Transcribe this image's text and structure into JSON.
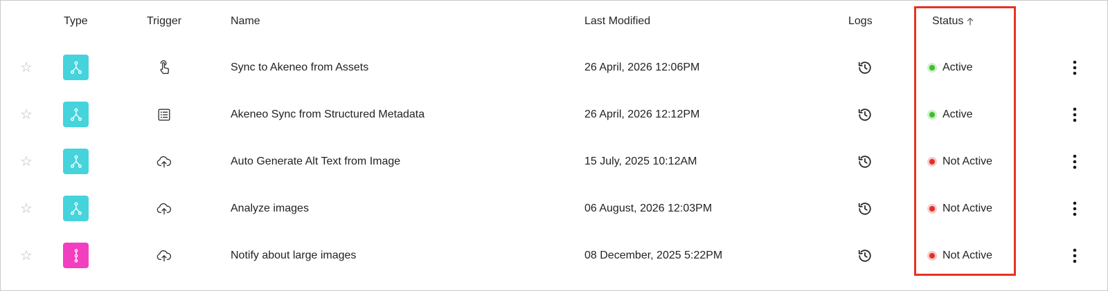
{
  "table": {
    "headers": {
      "type": "Type",
      "trigger": "Trigger",
      "name": "Name",
      "last_modified": "Last Modified",
      "logs": "Logs",
      "status": "Status",
      "status_sort_icon": "arrow-up-icon"
    },
    "rows": [
      {
        "star_icon": "star-outline-icon",
        "type_icon": "workflow-branch-icon",
        "type_color": "#45d3dc",
        "trigger_icon": "tap-hand-icon",
        "name": "Sync to Akeneo from Assets",
        "last_modified": "26 April, 2026 12:06PM",
        "logs_icon": "history-icon",
        "status": "Active",
        "status_color": "#3fbf2a",
        "menu_icon": "more-vertical-icon"
      },
      {
        "star_icon": "star-outline-icon",
        "type_icon": "workflow-branch-icon",
        "type_color": "#45d3dc",
        "trigger_icon": "list-document-icon",
        "name": "Akeneo Sync from Structured Metadata",
        "last_modified": "26 April, 2026 12:12PM",
        "logs_icon": "history-icon",
        "status": "Active",
        "status_color": "#3fbf2a",
        "menu_icon": "more-vertical-icon"
      },
      {
        "star_icon": "star-outline-icon",
        "type_icon": "workflow-branch-icon",
        "type_color": "#45d3dc",
        "trigger_icon": "cloud-upload-icon",
        "name": "Auto Generate Alt Text from Image",
        "last_modified": "15 July, 2025 10:12AM",
        "logs_icon": "history-icon",
        "status": "Not Active",
        "status_color": "#e0302a",
        "menu_icon": "more-vertical-icon"
      },
      {
        "star_icon": "star-outline-icon",
        "type_icon": "workflow-branch-icon",
        "type_color": "#45d3dc",
        "trigger_icon": "cloud-upload-icon",
        "name": "Analyze images",
        "last_modified": "06 August, 2026 12:03PM",
        "logs_icon": "history-icon",
        "status": "Not Active",
        "status_color": "#e0302a",
        "menu_icon": "more-vertical-icon"
      },
      {
        "star_icon": "star-outline-icon",
        "type_icon": "workflow-linear-icon",
        "type_color": "#f23fbf",
        "trigger_icon": "cloud-upload-icon",
        "name": "Notify about large images",
        "last_modified": "08 December, 2025 5:22PM",
        "logs_icon": "history-icon",
        "status": "Not Active",
        "status_color": "#e0302a",
        "menu_icon": "more-vertical-icon"
      }
    ]
  },
  "highlight_color": "#e8321f"
}
